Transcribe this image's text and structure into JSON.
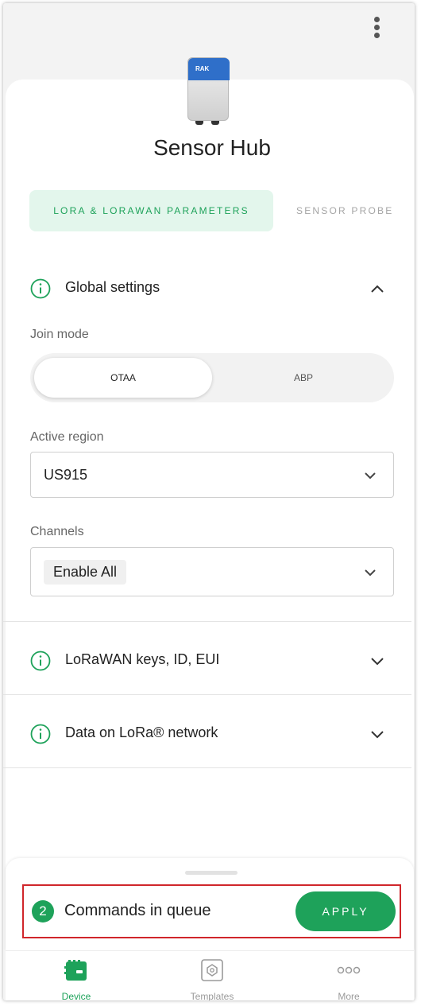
{
  "header": {
    "title": "Sensor Hub",
    "device_logo_text": "RAK"
  },
  "tabs": [
    {
      "label": "LORA & LORAWAN PARAMETERS",
      "active": true
    },
    {
      "label": "SENSOR PROBE",
      "active": false
    }
  ],
  "sections": {
    "global": {
      "title": "Global settings",
      "expanded": true,
      "join_mode": {
        "label": "Join mode",
        "options": [
          "OTAA",
          "ABP"
        ],
        "selected": "OTAA"
      },
      "active_region": {
        "label": "Active region",
        "value": "US915"
      },
      "channels": {
        "label": "Channels",
        "value": "Enable All"
      }
    },
    "keys": {
      "title": "LoRaWAN keys, ID, EUI",
      "expanded": false
    },
    "data": {
      "title": "Data on LoRa® network",
      "expanded": false
    }
  },
  "queue": {
    "count": "2",
    "text": "Commands in queue",
    "button_label": "APPLY"
  },
  "nav": [
    {
      "label": "Device",
      "icon": "device-icon",
      "active": true
    },
    {
      "label": "Templates",
      "icon": "templates-icon",
      "active": false
    },
    {
      "label": "More",
      "icon": "more-icon",
      "active": false
    }
  ],
  "colors": {
    "accent": "#1ea25a",
    "tab_active_bg": "#e3f6ec",
    "highlight_border": "#d0262b"
  }
}
